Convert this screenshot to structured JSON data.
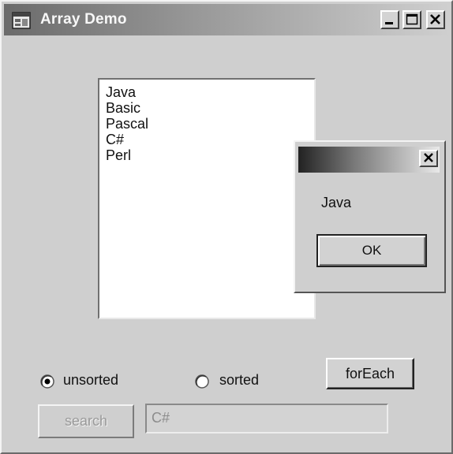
{
  "window": {
    "title": "Array Demo",
    "icon": "app-window-icon",
    "controls": [
      "minimize-icon",
      "maximize-icon",
      "close-icon"
    ]
  },
  "listbox": {
    "items": [
      "Java",
      "Basic",
      "Pascal",
      "C#",
      "Perl"
    ]
  },
  "message_box": {
    "message": "Java",
    "ok_label": "OK",
    "close_icon": "close-icon"
  },
  "options": {
    "unsorted_label": "unsorted",
    "sorted_label": "sorted",
    "selected": "unsorted"
  },
  "buttons": {
    "foreach_label": "forEach",
    "search_label": "search"
  },
  "search_field": {
    "value": "C#"
  }
}
